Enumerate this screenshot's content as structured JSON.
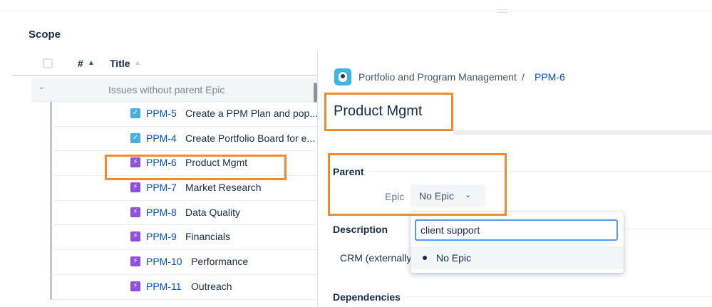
{
  "scope": {
    "title": "Scope"
  },
  "list": {
    "columns": {
      "number": "#",
      "number_sort": "▲",
      "title": "Title",
      "title_sort": "▲"
    },
    "group": {
      "label": "Issues without parent Epic",
      "chevron": "⌄"
    },
    "rows": [
      {
        "type": "task",
        "icon": "✓",
        "key": "PPM-5",
        "summary": "Create a PPM Plan and pop..."
      },
      {
        "type": "task",
        "icon": "✓",
        "key": "PPM-4",
        "summary": "Create Portfolio Board for e..."
      },
      {
        "type": "epic",
        "icon": "⚡",
        "key": "PPM-6",
        "summary": "Product Mgmt"
      },
      {
        "type": "epic",
        "icon": "⚡",
        "key": "PPM-7",
        "summary": "Market Research"
      },
      {
        "type": "epic",
        "icon": "⚡",
        "key": "PPM-8",
        "summary": "Data Quality"
      },
      {
        "type": "epic",
        "icon": "⚡",
        "key": "PPM-9",
        "summary": "Financials"
      },
      {
        "type": "epic",
        "icon": "⚡",
        "key": "PPM-10",
        "summary": "Performance"
      },
      {
        "type": "epic",
        "icon": "⚡",
        "key": "PPM-11",
        "summary": "Outreach"
      }
    ]
  },
  "detail": {
    "breadcrumb": {
      "project": "Portfolio and Program Management",
      "separator": "/",
      "key": "PPM-6"
    },
    "title": "Product Mgmt",
    "parent": {
      "heading": "Parent",
      "epic_label": "Epic",
      "epic_value": "No Epic",
      "chevron": "⌄"
    },
    "description": {
      "heading": "Description",
      "text": "CRM (externally"
    },
    "dependencies": {
      "heading": "Dependencies"
    }
  },
  "epic_popup": {
    "search_value": "client support",
    "options": [
      {
        "label": "No Epic"
      }
    ]
  },
  "colors": {
    "link": "#0052cc",
    "task_icon": "#4bade8",
    "epic_icon": "#904ee2",
    "highlight": "#f38b2c",
    "focus_ring": "#4c9aff"
  }
}
